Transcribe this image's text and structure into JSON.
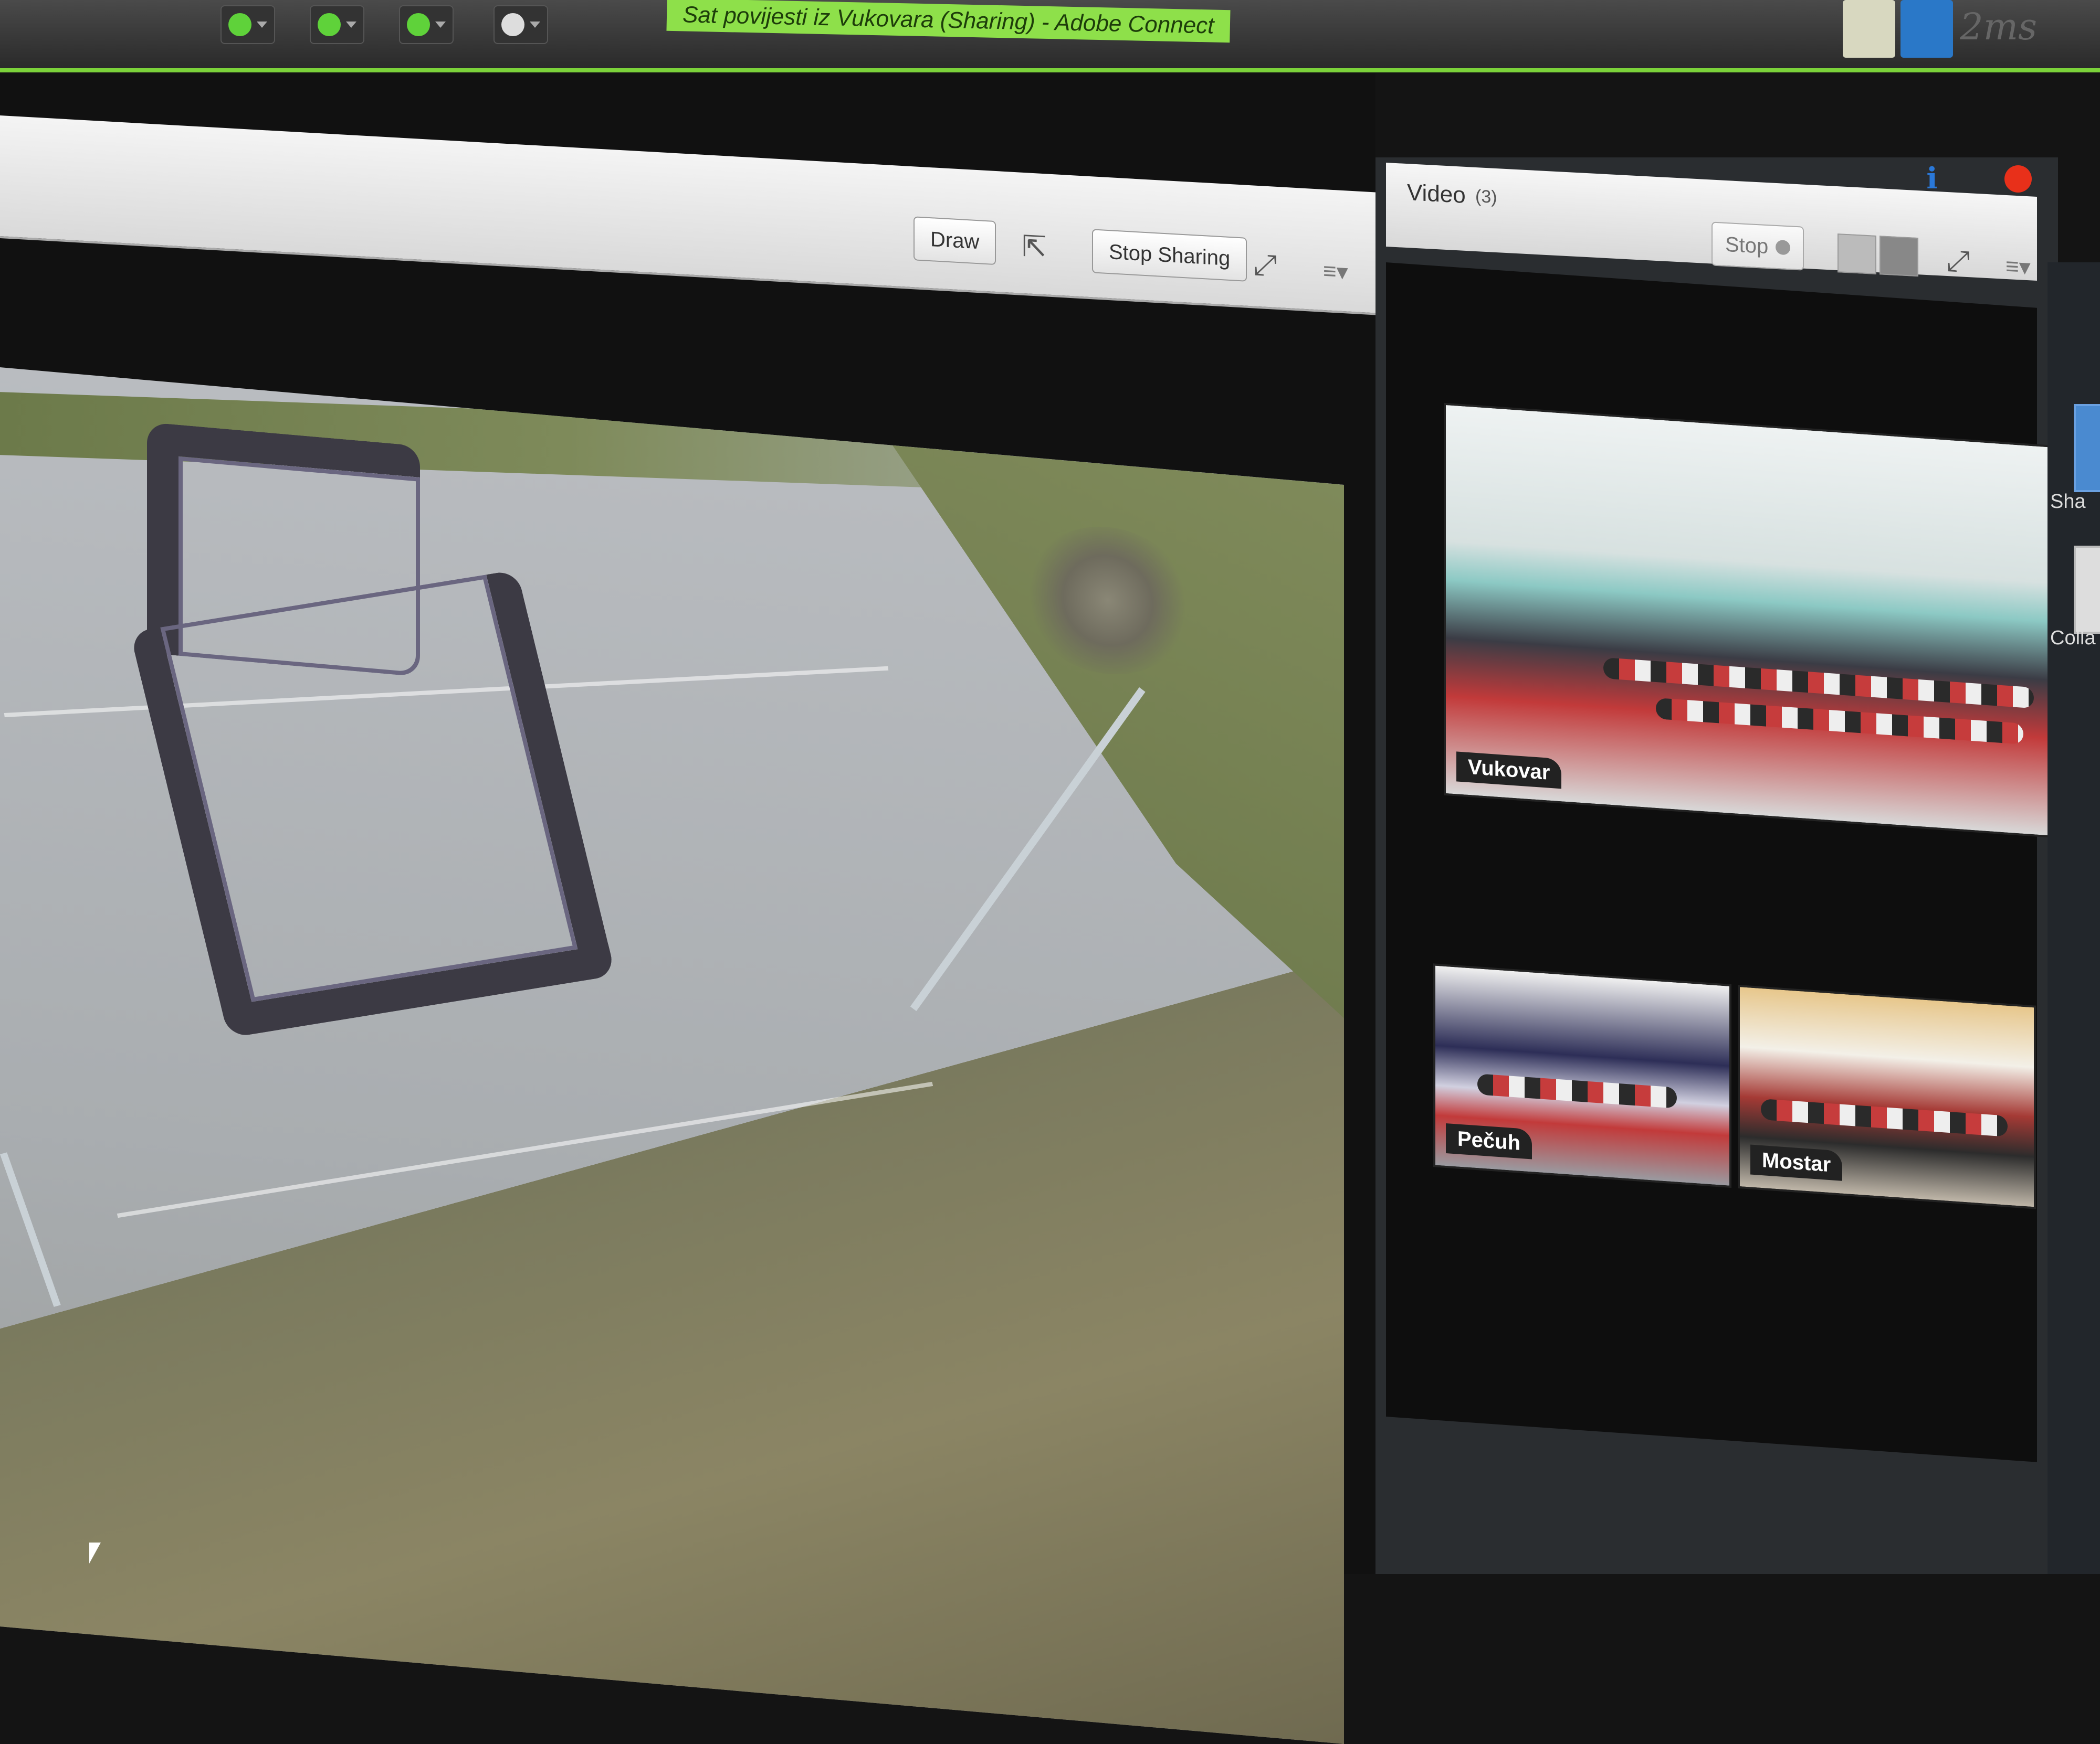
{
  "window": {
    "title": "Sat povijesti iz Vukovara (Sharing) - Adobe Connect",
    "brand_mark": "2ms"
  },
  "toolbar": {
    "icons": [
      "speaker-icon",
      "microphone-icon",
      "webcam-icon",
      "raise-hand-icon"
    ]
  },
  "share_pod": {
    "draw_label": "Draw",
    "stop_sharing_label": "Stop Sharing",
    "menu_glyph": "≡▾"
  },
  "video_pod": {
    "title": "Video",
    "count": "(3)",
    "stop_label": "Stop",
    "menu_glyph": "≡▾",
    "tiles": [
      {
        "label": "Vukovar"
      },
      {
        "label": "Pečuh"
      },
      {
        "label": "Mostar"
      }
    ]
  },
  "side": {
    "labels": [
      "Sha",
      "Colla"
    ]
  },
  "colors": {
    "accent_green": "#7bd23a",
    "record_red": "#e8301a"
  }
}
